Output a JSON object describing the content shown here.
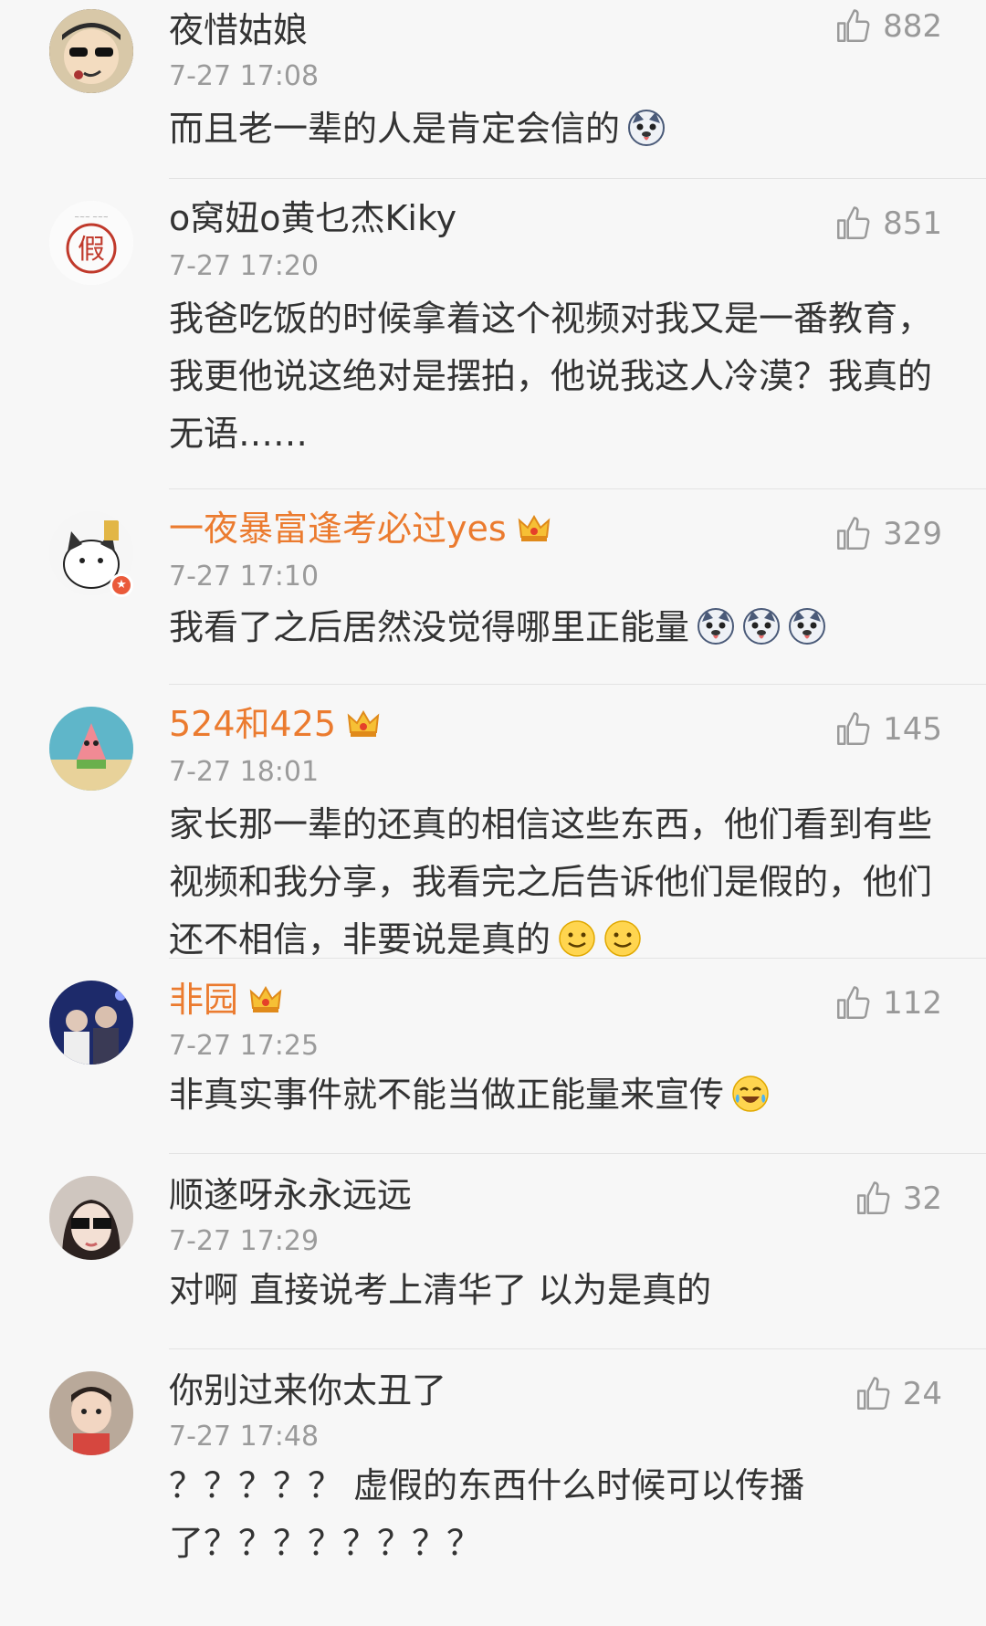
{
  "comments": [
    {
      "username": "夜惜姑娘",
      "time": "7-27 17:08",
      "likes": "882",
      "vip": false,
      "text": "而且老一辈的人是肯定会信的",
      "emoji": [
        "doge"
      ]
    },
    {
      "username": "o窝妞o黄乜杰Kiky",
      "time": "7-27 17:20",
      "likes": "851",
      "vip": false,
      "text": "我爸吃饭的时候拿着这个视频对我又是一番教育，我更他说这绝对是摆拍，他说我这人冷漠？我真的无语……",
      "emoji": []
    },
    {
      "username": "一夜暴富逢考必过yes",
      "time": "7-27 17:10",
      "likes": "329",
      "vip": true,
      "text": "我看了之后居然没觉得哪里正能量",
      "emoji": [
        "doge",
        "doge",
        "doge"
      ]
    },
    {
      "username": "524和425",
      "time": "7-27 18:01",
      "likes": "145",
      "vip": true,
      "text": "家长那一辈的还真的相信这些东西，他们看到有些视频和我分享，我看完之后告诉他们是假的，他们还不相信，非要说是真的",
      "emoji": [
        "smile",
        "smile"
      ]
    },
    {
      "username": "非园",
      "time": "7-27 17:25",
      "likes": "112",
      "vip": true,
      "text": "非真实事件就不能当做正能量来宣传",
      "emoji": [
        "laugh-cry"
      ]
    },
    {
      "username": "顺遂呀永永远远",
      "time": "7-27 17:29",
      "likes": "32",
      "vip": false,
      "text": "对啊 直接说考上清华了 以为是真的",
      "emoji": []
    },
    {
      "username": "你别过来你太丑了",
      "time": "7-27 17:48",
      "likes": "24",
      "vip": false,
      "text": "？？？？？ 虚假的东西什么时候可以传播了？？？？？？？？",
      "emoji": []
    }
  ],
  "colors": {
    "vip_name": "#eb7b2f",
    "normal_name": "#333333",
    "meta": "#9b9b9b",
    "background": "#f7f7f7"
  },
  "icons": {
    "like": "thumbs-up-icon",
    "crown": "vip-crown-icon"
  }
}
